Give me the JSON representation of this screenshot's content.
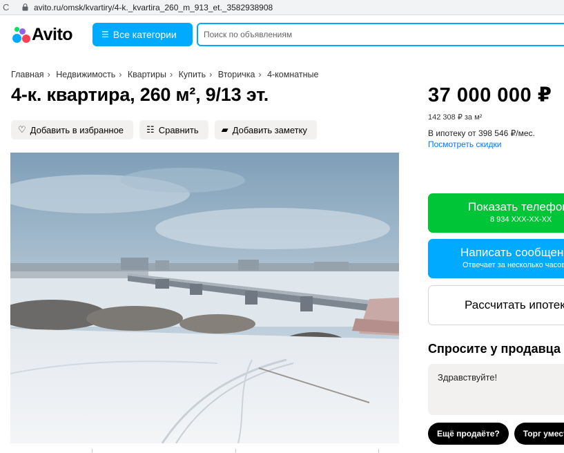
{
  "browser": {
    "url": "avito.ru/omsk/kvartiry/4-k._kvartira_260_m_913_et._3582938908"
  },
  "header": {
    "logo_text": "Avito",
    "categories_button": "Все категории",
    "search_placeholder": "Поиск по объявлениям"
  },
  "breadcrumbs": [
    "Главная",
    "Недвижимость",
    "Квартиры",
    "Купить",
    "Вторичка",
    "4-комнатные"
  ],
  "listing": {
    "title": "4-к. квартира, 260 м², 9/13 эт.",
    "actions": {
      "favorite": "Добавить в избранное",
      "compare": "Сравнить",
      "note": "Добавить заметку"
    },
    "price": "37 000 000 ₽",
    "price_per_m2": "142 308 ₽ за м²",
    "mortgage_text": "В ипотеку от 398 546 ₽/мес.",
    "discounts_link": "Посмотреть скидки"
  },
  "contact": {
    "show_phone": "Показать телефон",
    "phone_mask": "8 934 XXX-XX-XX",
    "write_message": "Написать сообщение",
    "write_sub": "Отвечает за несколько часов",
    "calc_mortgage": "Рассчитать ипотеку"
  },
  "ask_seller": {
    "title": "Спросите у продавца",
    "message": "Здравствуйте!",
    "chips": [
      "Ещё продаёте?",
      "Торг уместен?"
    ]
  },
  "colors": {
    "accent_blue": "#00aaff",
    "green": "#00c637",
    "link": "#0077ff"
  }
}
